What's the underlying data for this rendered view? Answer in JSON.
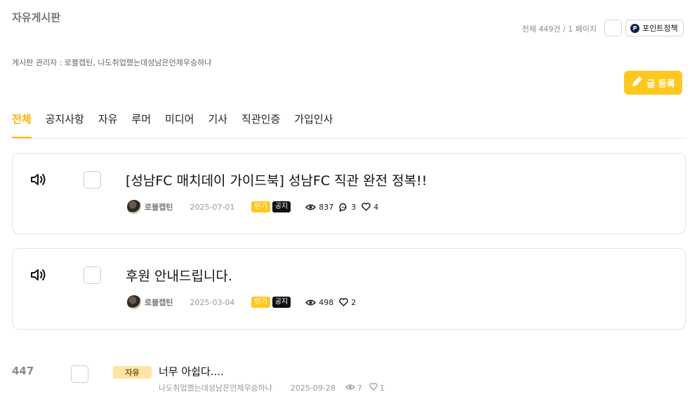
{
  "board": {
    "title": "자유게시판",
    "post_count": "전체 449건 / 1 페이지",
    "point_policy_label": "포인트정책",
    "point_icon_letter": "P",
    "admins": "게시판 관리자 : 로블캡틴, 나도취업했는데성남은언제우승하냐",
    "write_label": "글 등록"
  },
  "tabs": [
    {
      "label": "전체",
      "active": true
    },
    {
      "label": "공지사항"
    },
    {
      "label": "자유"
    },
    {
      "label": "루머"
    },
    {
      "label": "미디어"
    },
    {
      "label": "기사"
    },
    {
      "label": "직관인증"
    },
    {
      "label": "가입인사"
    }
  ],
  "notices": [
    {
      "title": "[성남FC 매치데이 가이드북] 성남FC 직관 완전 정복!!",
      "author": "로블캡틴",
      "date": "2025-07-01",
      "badge_hot": "인기",
      "badge_notice": "공지",
      "views": "837",
      "comments": "3",
      "likes": "4"
    },
    {
      "title": "후원 안내드립니다.",
      "author": "로블캡틴",
      "date": "2025-03-04",
      "badge_hot": "인기",
      "badge_notice": "공지",
      "views": "498",
      "likes": "2"
    }
  ],
  "posts": [
    {
      "number": "447",
      "category": "자유",
      "title": "너무 아쉽다....",
      "author": "나도취업했는데성남은언제우승하냐",
      "date": "2025-09-28",
      "views": "7",
      "likes": "1"
    }
  ],
  "colors": {
    "accent": "#ffc81f",
    "active_tab": "#ffb400",
    "category_badge": "#ffe4a6"
  }
}
